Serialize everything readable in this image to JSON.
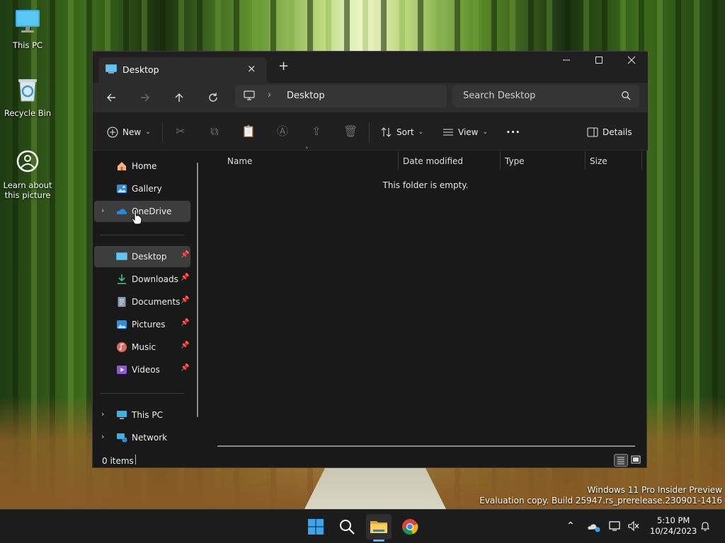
{
  "desktop": {
    "icons": [
      {
        "label": "This PC",
        "icon": "monitor-icon"
      },
      {
        "label": "Recycle Bin",
        "icon": "recycle-bin-icon"
      },
      {
        "label": "Learn about this picture",
        "icon": "camera-icon"
      }
    ],
    "watermark_line1": "Windows 11 Pro Insider Preview",
    "watermark_line2": "Evaluation copy. Build 25947.rs_prerelease.230901-1416"
  },
  "window": {
    "tab_title": "Desktop",
    "new_tab_label": "+",
    "close_tab_label": "×",
    "address": {
      "crumb": "Desktop"
    },
    "search": {
      "placeholder": "Search Desktop"
    },
    "toolbar": {
      "new_label": "New",
      "sort_label": "Sort",
      "view_label": "View",
      "more_label": "···",
      "details_label": "Details"
    },
    "sidebar": {
      "home": "Home",
      "gallery": "Gallery",
      "onedrive": "OneDrive",
      "desktop": "Desktop",
      "downloads": "Downloads",
      "documents": "Documents",
      "pictures": "Pictures",
      "music": "Music",
      "videos": "Videos",
      "this_pc": "This PC",
      "network": "Network"
    },
    "columns": {
      "name": "Name",
      "date": "Date modified",
      "type": "Type",
      "size": "Size"
    },
    "empty_message": "This folder is empty.",
    "status": "0 items"
  },
  "taskbar": {
    "time": "5:10 PM",
    "date": "10/24/2023"
  },
  "colors": {
    "accent": "#5fb2f2",
    "window_bg": "#191919",
    "selected_bg": "#3d3d3d"
  }
}
